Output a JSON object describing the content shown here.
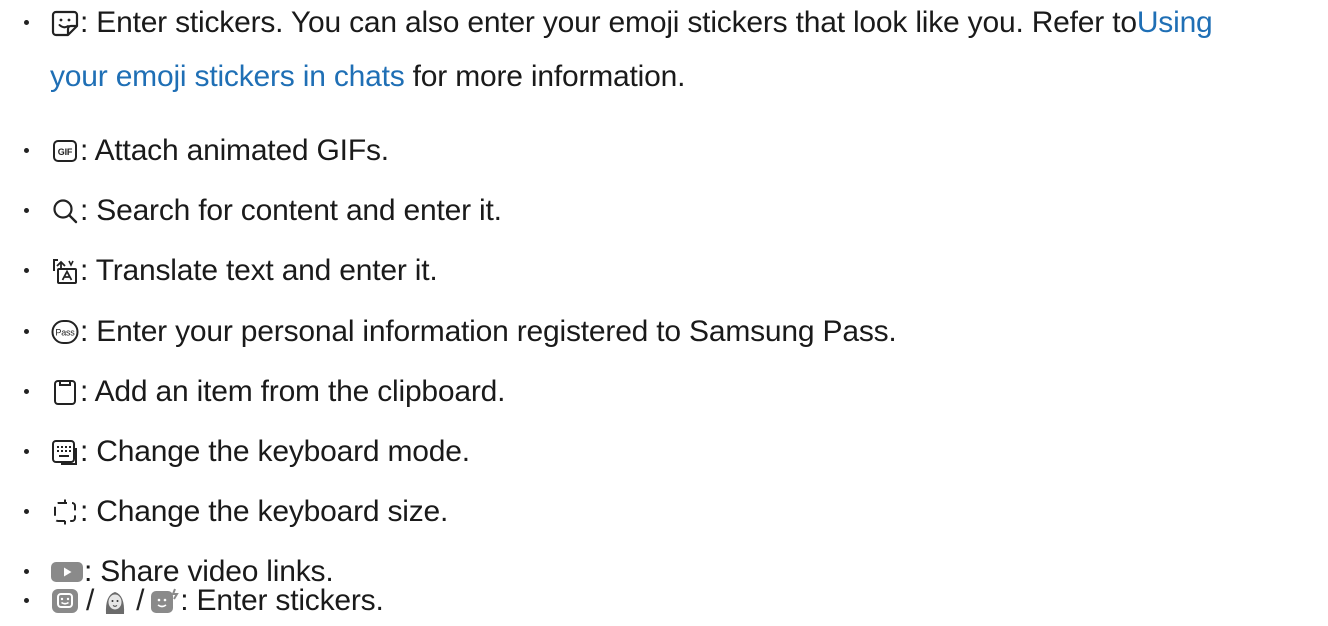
{
  "items": [
    {
      "icon": "sticker-icon",
      "text_a": " : Enter stickers. You can also enter your emoji stickers that look like you. Refer to ",
      "link_a": "Using",
      "link_b": "your emoji stickers in chats",
      "text_b": " for more information."
    },
    {
      "icon": "gif-icon",
      "text": " : Attach animated GIFs."
    },
    {
      "icon": "search-icon",
      "text": " : Search for content and enter it."
    },
    {
      "icon": "translate-icon",
      "text": " : Translate text and enter it."
    },
    {
      "icon": "samsung-pass-icon",
      "text": " : Enter your personal information registered to Samsung Pass."
    },
    {
      "icon": "clipboard-icon",
      "text": " : Add an item from the clipboard."
    },
    {
      "icon": "keyboard-mode-icon",
      "text": " : Change the keyboard mode."
    },
    {
      "icon": "keyboard-size-icon",
      "text": " : Change the keyboard size."
    },
    {
      "icon": "video-icon",
      "text": " : Share video links."
    },
    {
      "icons": [
        "bitmoji-sticker-icon",
        "ar-emoji-icon",
        "mojitok-sticker-icon"
      ],
      "separator": "/",
      "text": " : Enter stickers."
    }
  ]
}
